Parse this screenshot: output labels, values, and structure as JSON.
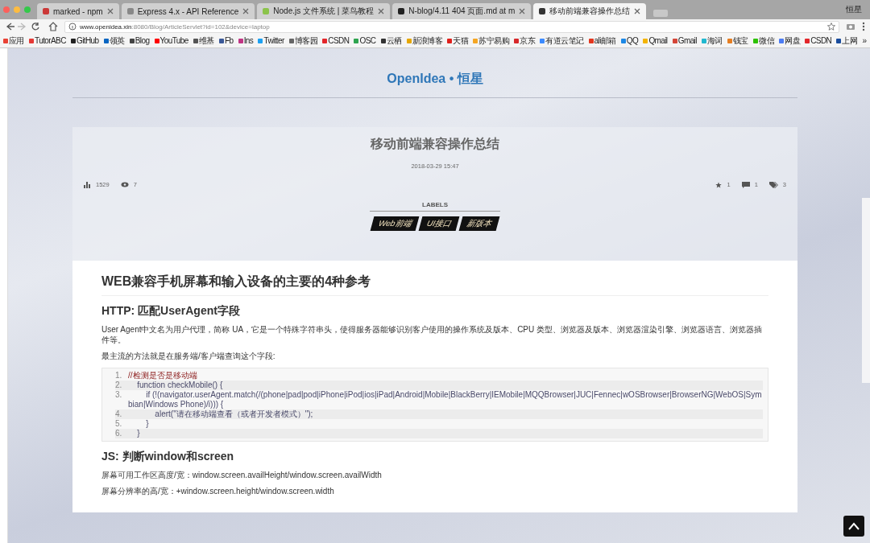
{
  "browser": {
    "tabs": [
      {
        "title": "marked - npm",
        "selected": false,
        "color": "#cb3837"
      },
      {
        "title": "Express 4.x - API Reference",
        "selected": false,
        "color": "#888888"
      },
      {
        "title": "Node.js 文件系统 | 菜鸟教程",
        "selected": false,
        "color": "#8bc34a"
      },
      {
        "title": "N-blog/4.11 404 页面.md at m",
        "selected": false,
        "color": "#222222"
      },
      {
        "title": "移动前端兼容操作总结",
        "selected": true,
        "color": "#333333"
      }
    ],
    "profile": "恒星",
    "url_host": "www.openidea.xin",
    "url_path": ":8080/Blog/ArticleServlet?id=102&device=laptop",
    "bookmarks": [
      {
        "label": "应用",
        "color": "#e94235"
      },
      {
        "label": "TutorABC",
        "color": "#e53935"
      },
      {
        "label": "GitHub",
        "color": "#222222"
      },
      {
        "label": "领英",
        "color": "#0a66c2"
      },
      {
        "label": "Blog",
        "color": "#444444"
      },
      {
        "label": "YouTube",
        "color": "#ff0000"
      },
      {
        "label": "维基",
        "color": "#555555"
      },
      {
        "label": "Fb",
        "color": "#3b5998"
      },
      {
        "label": "Ins",
        "color": "#c13584"
      },
      {
        "label": "Twitter",
        "color": "#1da1f2"
      },
      {
        "label": "博客园",
        "color": "#666666"
      },
      {
        "label": "CSDN",
        "color": "#e3262a"
      },
      {
        "label": "OSC",
        "color": "#2ea44f"
      },
      {
        "label": "云栖",
        "color": "#333333"
      },
      {
        "label": "新浪博客",
        "color": "#e6a700"
      },
      {
        "label": "天猫",
        "color": "#e0201b"
      },
      {
        "label": "苏宁易购",
        "color": "#f5a623"
      },
      {
        "label": "京东",
        "color": "#d7282a"
      },
      {
        "label": "有道云笔记",
        "color": "#3d8bff"
      },
      {
        "label": "ali邮箱",
        "color": "#e3371e"
      },
      {
        "label": "QQ",
        "color": "#1e88e5"
      },
      {
        "label": "Qmail",
        "color": "#f4b400"
      },
      {
        "label": "Gmail",
        "color": "#d44638"
      },
      {
        "label": "海词",
        "color": "#22b8cf"
      },
      {
        "label": "钱宝",
        "color": "#e67e22"
      },
      {
        "label": "微信",
        "color": "#2dc100"
      },
      {
        "label": "网盘",
        "color": "#4c7cf3"
      },
      {
        "label": "CSDN",
        "color": "#e3262a"
      },
      {
        "label": "上网",
        "color": "#1a4c9c"
      }
    ],
    "more": "»"
  },
  "site": {
    "title": "OpenIdea • 恒星"
  },
  "article": {
    "title": "移动前端兼容操作总结",
    "date": "2018-03-29 15:47",
    "views": "1529",
    "eyes": "7",
    "stars": "1",
    "comments": "1",
    "tags_count": "3",
    "labels_heading": "LABELS",
    "labels": [
      "Web前端",
      "UI接口",
      "新版本"
    ],
    "h1": "WEB兼容手机屏幕和输入设备的主要的4种参考",
    "h2_http": "HTTP: 匹配UserAgent字段",
    "p1": "User Agent中文名为用户代理，简称 UA，它是一个特殊字符串头，使得服务器能够识别客户使用的操作系统及版本、CPU 类型、浏览器及版本、浏览器渲染引擎、浏览器语言、浏览器插件等。",
    "p2": "最主流的方法就是在服务端/客户端查询这个字段:",
    "code": [
      {
        "num": "1.",
        "text": "//检测是否是移动端",
        "kind": "comment"
      },
      {
        "num": "2.",
        "text": "    function checkMobile() {",
        "kind": "code"
      },
      {
        "num": "3.",
        "text": "        if (!(navigator.userAgent.match(/(phone|pad|pod|iPhone|iPod|ios|iPad|Android|Mobile|BlackBerry|IEMobile|MQQBrowser|JUC|Fennec|wOSBrowser|BrowserNG|WebOS|Symbian|Windows Phone)/i))) {",
        "kind": "code"
      },
      {
        "num": "4.",
        "text": "            alert(\"请在移动端查看（或者开发者模式）\");",
        "kind": "code"
      },
      {
        "num": "5.",
        "text": "        }",
        "kind": "code"
      },
      {
        "num": "6.",
        "text": "    }",
        "kind": "code"
      }
    ],
    "h2_js": "JS: 判断window和screen",
    "p3": "屏幕可用工作区高度/宽：window.screen.availHeight/window.screen.availWidth",
    "p4": "屏幕分辨率的高/宽：+window.screen.height/window.screen.width"
  }
}
